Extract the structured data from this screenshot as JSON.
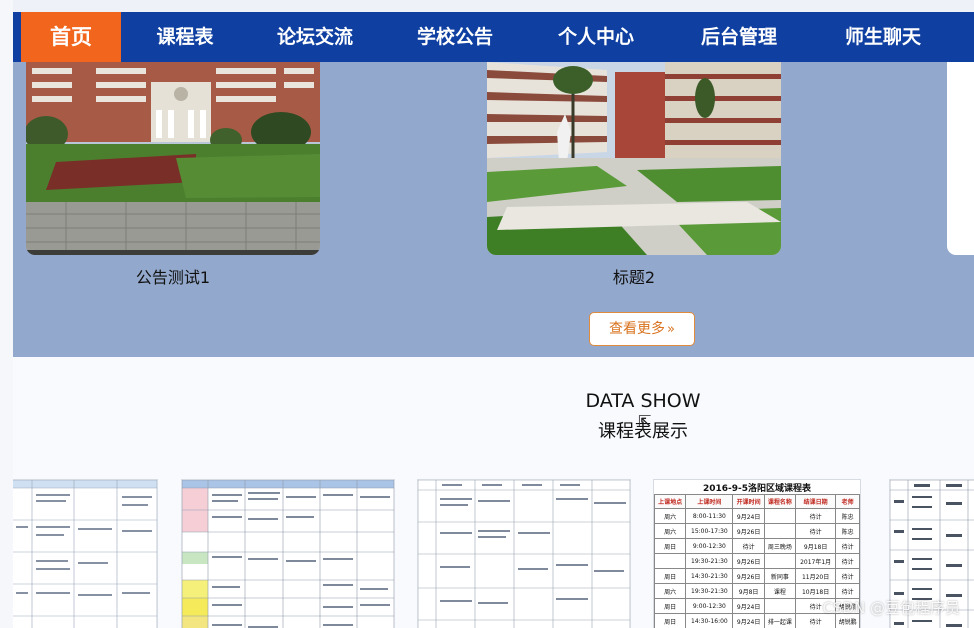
{
  "nav": {
    "items": [
      {
        "label": "首页",
        "active": true
      },
      {
        "label": "课程表"
      },
      {
        "label": "论坛交流"
      },
      {
        "label": "学校公告"
      },
      {
        "label": "个人中心"
      },
      {
        "label": "后台管理"
      },
      {
        "label": "师生聊天"
      }
    ]
  },
  "notices": [
    {
      "caption": "公告测试1"
    },
    {
      "caption": "标题2"
    }
  ],
  "more_button": {
    "label": "查看更多",
    "chevron": "»"
  },
  "data_show": {
    "title": "DATA SHOW",
    "subtitle": "课程表展示",
    "sheet_heading": "2016-9-5洛阳区域课程表",
    "sheet_columns": [
      "上课地点",
      "上课时间",
      "开课时间",
      "课程名称",
      "结课日期",
      "老师"
    ],
    "sheet_rows": [
      [
        "周六",
        "8:00-11:30",
        "9月24日",
        "",
        "待计",
        "陈忠"
      ],
      [
        "周六",
        "15:00-17:30",
        "9月26日",
        "",
        "待计",
        "陈忠"
      ],
      [
        "周日",
        "9:00-12:30",
        "待计",
        "周三晚场",
        "9月18日",
        "待计"
      ],
      [
        "",
        "19:30-21:30",
        "9月26日",
        "",
        "2017年1月",
        "待计"
      ],
      [
        "周日",
        "14:30-21:30",
        "9月26日",
        "新同事",
        "11月20日",
        "待计"
      ],
      [
        "周六",
        "19:30-21:30",
        "9月8日",
        "课程",
        "10月18日",
        "待计"
      ],
      [
        "周日",
        "9:00-12:30",
        "9月24日",
        "",
        "待计",
        "胡锐鹏"
      ],
      [
        "周日",
        "14:30-16:00",
        "9月24日",
        "排一起课",
        "待计",
        "胡锐鹏"
      ],
      [
        "周日",
        "19:30-21:30",
        "9月26日",
        "",
        "待计",
        "胡锐鹏"
      ]
    ]
  },
  "watermark": "CSDN @豆包程序员"
}
